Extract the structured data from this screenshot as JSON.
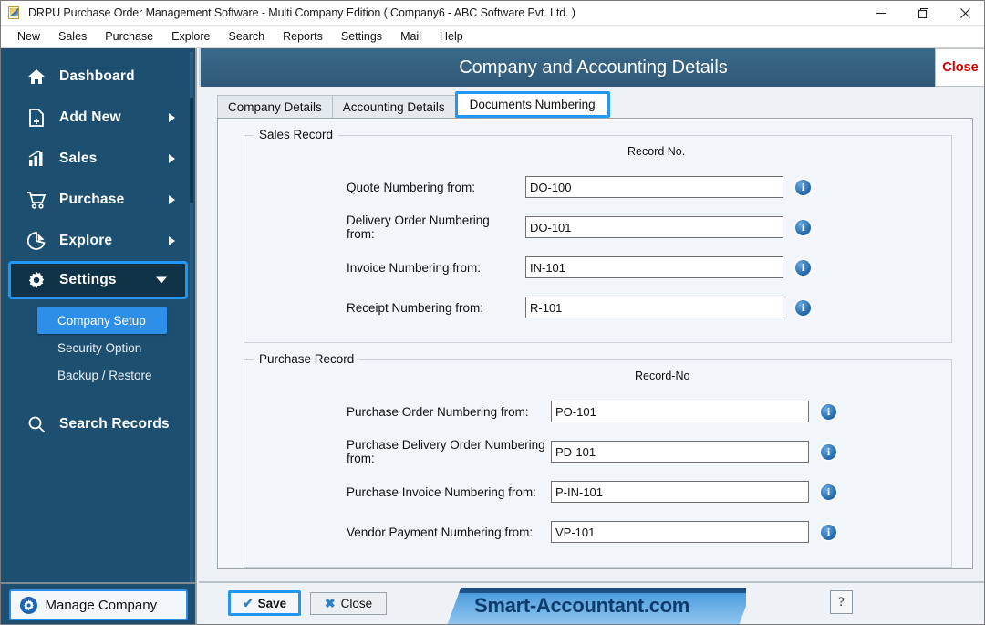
{
  "window": {
    "title": "DRPU Purchase Order Management Software - Multi Company Edition ( Company6 - ABC Software Pvt. Ltd. )",
    "app_icon": "document-star-icon",
    "controls": {
      "minimize": "minimize-icon",
      "maximize": "maximize-icon",
      "close": "close-icon"
    }
  },
  "menubar": {
    "items": [
      {
        "label": "New"
      },
      {
        "label": "Sales"
      },
      {
        "label": "Purchase"
      },
      {
        "label": "Explore"
      },
      {
        "label": "Search"
      },
      {
        "label": "Reports"
      },
      {
        "label": "Settings"
      },
      {
        "label": "Mail"
      },
      {
        "label": "Help"
      }
    ]
  },
  "sidebar": {
    "items": [
      {
        "label": "Dashboard",
        "icon": "home-icon",
        "has_chevron": false,
        "active": false
      },
      {
        "label": "Add New",
        "icon": "file-plus-icon",
        "has_chevron": true,
        "active": false
      },
      {
        "label": "Sales",
        "icon": "bar-chart-icon",
        "has_chevron": true,
        "active": false
      },
      {
        "label": "Purchase",
        "icon": "cart-icon",
        "has_chevron": true,
        "active": false
      },
      {
        "label": "Explore",
        "icon": "pie-chart-icon",
        "has_chevron": true,
        "active": false
      },
      {
        "label": "Settings",
        "icon": "gear-icon",
        "has_chevron": true,
        "active": true
      }
    ],
    "submenu": [
      {
        "label": "Company Setup",
        "selected": true
      },
      {
        "label": "Security Option",
        "selected": false
      },
      {
        "label": "Backup / Restore",
        "selected": false
      }
    ],
    "search_records": {
      "label": "Search Records",
      "icon": "search-icon"
    },
    "manage_company": {
      "label": "Manage Company",
      "icon": "gear-icon"
    }
  },
  "page": {
    "title": "Company and Accounting Details",
    "close_label": "Close",
    "tabs": [
      {
        "label": "Company Details",
        "active": false
      },
      {
        "label": "Accounting Details",
        "active": false
      },
      {
        "label": "Documents Numbering",
        "active": true
      }
    ]
  },
  "sales_record": {
    "legend": "Sales Record",
    "column_header": "Record No.",
    "fields": [
      {
        "label": "Quote Numbering from:",
        "value": "DO-100",
        "info": "info-icon"
      },
      {
        "label": "Delivery Order Numbering from:",
        "value": "DO-101",
        "info": "info-icon"
      },
      {
        "label": "Invoice Numbering from:",
        "value": "IN-101",
        "info": "info-icon"
      },
      {
        "label": "Receipt Numbering from:",
        "value": "R-101",
        "info": "info-icon"
      }
    ]
  },
  "purchase_record": {
    "legend": "Purchase Record",
    "column_header": "Record-No",
    "fields": [
      {
        "label": "Purchase Order Numbering from:",
        "value": "PO-101",
        "info": "info-icon"
      },
      {
        "label": "Purchase Delivery Order Numbering from:",
        "value": "PD-101",
        "info": "info-icon"
      },
      {
        "label": "Purchase Invoice Numbering from:",
        "value": "P-IN-101",
        "info": "info-icon"
      },
      {
        "label": "Vendor Payment Numbering from:",
        "value": "VP-101",
        "info": "info-icon"
      }
    ]
  },
  "bottombar": {
    "save_label": "Save",
    "save_accel": "S",
    "close_label": "Close",
    "brand": "Smart-Accountant.com",
    "help_label": "?"
  },
  "colors": {
    "sidebar_bg": "#1d5070",
    "header_bg": "#35607f",
    "accent_blue": "#2196f3",
    "selected_sub": "#2e8fe8",
    "close_red": "#d00000",
    "panel_bg": "#f2f6fa",
    "info_blue": "#2a6fb0"
  }
}
